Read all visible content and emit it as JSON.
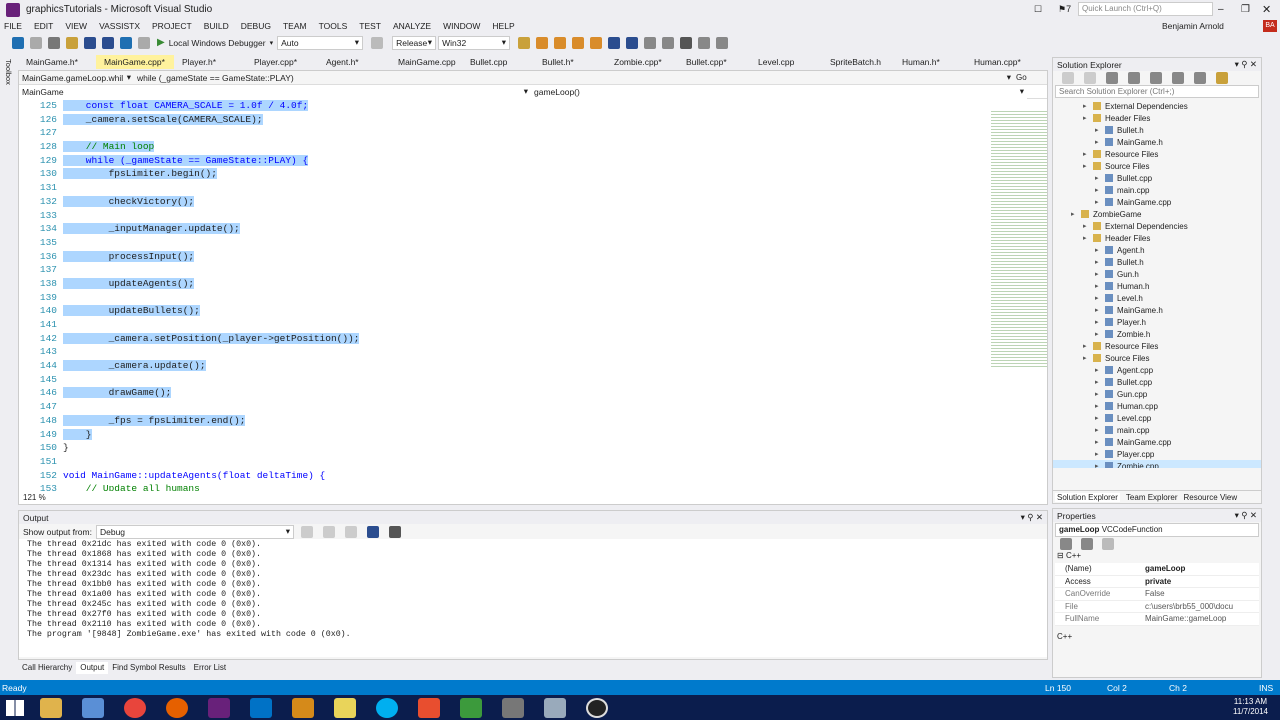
{
  "window": {
    "title": "graphicsTutorials - Microsoft Visual Studio",
    "user": "Benjamin Arnold",
    "user_initials": "BA",
    "quick_launch_placeholder": "Quick Launch (Ctrl+Q)",
    "notif_count": "7"
  },
  "menu": [
    "FILE",
    "EDIT",
    "VIEW",
    "VASSISTX",
    "PROJECT",
    "BUILD",
    "DEBUG",
    "TEAM",
    "TOOLS",
    "TEST",
    "ANALYZE",
    "WINDOW",
    "HELP"
  ],
  "toolbar": {
    "debugger": "Local Windows Debugger",
    "config1": "Auto",
    "config2": "Release",
    "platform": "Win32"
  },
  "tabs": [
    "MainGame.h*",
    "MainGame.cpp*",
    "Player.h*",
    "Player.cpp*",
    "Agent.h*",
    "MainGame.cpp",
    "Bullet.cpp",
    "Bullet.h*",
    "Zombie.cpp*",
    "Bullet.cpp*",
    "Level.cpp",
    "SpriteBatch.h",
    "Human.h*",
    "Human.cpp*"
  ],
  "nav": {
    "file": "MainGame.gameLoop.whil",
    "scope": "while (_gameState == GameState::PLAY)",
    "class": "MainGame",
    "member": "gameLoop()",
    "go": "Go"
  },
  "code": [
    {
      "n": "125",
      "t": "    const float CAMERA_SCALE = 1.0f / 4.0f;",
      "sel": true
    },
    {
      "n": "126",
      "t": "    _camera.setScale(CAMERA_SCALE);",
      "sel": true
    },
    {
      "n": "127",
      "t": "",
      "sel": true
    },
    {
      "n": "128",
      "t": "    // Main loop",
      "sel": true
    },
    {
      "n": "129",
      "t": "    while (_gameState == GameState::PLAY) {",
      "sel": true
    },
    {
      "n": "130",
      "t": "        fpsLimiter.begin();",
      "sel": true
    },
    {
      "n": "131",
      "t": "",
      "sel": true
    },
    {
      "n": "132",
      "t": "        checkVictory();",
      "sel": true
    },
    {
      "n": "133",
      "t": "",
      "sel": true
    },
    {
      "n": "134",
      "t": "        _inputManager.update();",
      "sel": true
    },
    {
      "n": "135",
      "t": "",
      "sel": true
    },
    {
      "n": "136",
      "t": "        processInput();",
      "sel": true
    },
    {
      "n": "137",
      "t": "",
      "sel": true
    },
    {
      "n": "138",
      "t": "        updateAgents();",
      "sel": true
    },
    {
      "n": "139",
      "t": "",
      "sel": true
    },
    {
      "n": "140",
      "t": "        updateBullets();",
      "sel": true
    },
    {
      "n": "141",
      "t": "",
      "sel": true
    },
    {
      "n": "142",
      "t": "        _camera.setPosition(_player->getPosition());",
      "sel": true
    },
    {
      "n": "143",
      "t": "",
      "sel": true
    },
    {
      "n": "144",
      "t": "        _camera.update();",
      "sel": true
    },
    {
      "n": "145",
      "t": "",
      "sel": true
    },
    {
      "n": "146",
      "t": "        drawGame();",
      "sel": true
    },
    {
      "n": "147",
      "t": "",
      "sel": true
    },
    {
      "n": "148",
      "t": "        _fps = fpsLimiter.end();",
      "sel": true
    },
    {
      "n": "149",
      "t": "    }",
      "sel": true
    },
    {
      "n": "150",
      "t": "}",
      "sel": false
    },
    {
      "n": "151",
      "t": "",
      "sel": false
    },
    {
      "n": "152",
      "t": "void MainGame::updateAgents(float deltaTime) {",
      "sel": false
    },
    {
      "n": "153",
      "t": "    // Update all humans",
      "sel": false
    }
  ],
  "zoom": "121 %",
  "solution_explorer": {
    "title": "Solution Explorer",
    "search_placeholder": "Search Solution Explorer (Ctrl+;)",
    "items": [
      {
        "label": "External Dependencies",
        "indent": 2
      },
      {
        "label": "Header Files",
        "indent": 2
      },
      {
        "label": "Bullet.h",
        "indent": 3
      },
      {
        "label": "MainGame.h",
        "indent": 3
      },
      {
        "label": "Resource Files",
        "indent": 2
      },
      {
        "label": "Source Files",
        "indent": 2
      },
      {
        "label": "Bullet.cpp",
        "indent": 3
      },
      {
        "label": "main.cpp",
        "indent": 3
      },
      {
        "label": "MainGame.cpp",
        "indent": 3
      },
      {
        "label": "ZombieGame",
        "indent": 1
      },
      {
        "label": "External Dependencies",
        "indent": 2
      },
      {
        "label": "Header Files",
        "indent": 2
      },
      {
        "label": "Agent.h",
        "indent": 3
      },
      {
        "label": "Bullet.h",
        "indent": 3
      },
      {
        "label": "Gun.h",
        "indent": 3
      },
      {
        "label": "Human.h",
        "indent": 3
      },
      {
        "label": "Level.h",
        "indent": 3
      },
      {
        "label": "MainGame.h",
        "indent": 3
      },
      {
        "label": "Player.h",
        "indent": 3
      },
      {
        "label": "Zombie.h",
        "indent": 3
      },
      {
        "label": "Resource Files",
        "indent": 2
      },
      {
        "label": "Source Files",
        "indent": 2
      },
      {
        "label": "Agent.cpp",
        "indent": 3
      },
      {
        "label": "Bullet.cpp",
        "indent": 3
      },
      {
        "label": "Gun.cpp",
        "indent": 3
      },
      {
        "label": "Human.cpp",
        "indent": 3
      },
      {
        "label": "Level.cpp",
        "indent": 3
      },
      {
        "label": "main.cpp",
        "indent": 3
      },
      {
        "label": "MainGame.cpp",
        "indent": 3
      },
      {
        "label": "Player.cpp",
        "indent": 3
      },
      {
        "label": "Zombie.cpp",
        "indent": 3,
        "selected": true
      }
    ],
    "tabs": [
      "Solution Explorer",
      "Team Explorer",
      "Resource View"
    ]
  },
  "output": {
    "title": "Output",
    "show_label": "Show output from:",
    "source": "Debug",
    "lines": [
      "The thread 0x21dc has exited with code 0 (0x0).",
      "The thread 0x1868 has exited with code 0 (0x0).",
      "The thread 0x1314 has exited with code 0 (0x0).",
      "The thread 0x23dc has exited with code 0 (0x0).",
      "The thread 0x1bb0 has exited with code 0 (0x0).",
      "The thread 0x1a00 has exited with code 0 (0x0).",
      "The thread 0x245c has exited with code 0 (0x0).",
      "The thread 0x27f0 has exited with code 0 (0x0).",
      "The thread 0x2110 has exited with code 0 (0x0).",
      "The program '[9848] ZombieGame.exe' has exited with code 0 (0x0)."
    ]
  },
  "bottom_tabs": [
    "Call Hierarchy",
    "Output",
    "Find Symbol Results",
    "Error List"
  ],
  "properties": {
    "title": "Properties",
    "object": "gameLoop",
    "object_type": "VCCodeFunction",
    "category": "C++",
    "rows": [
      {
        "k": "(Name)",
        "v": "gameLoop"
      },
      {
        "k": "Access",
        "v": "private"
      },
      {
        "k": "CanOverride",
        "v": "False"
      },
      {
        "k": "File",
        "v": "c:\\users\\brb55_000\\docu"
      },
      {
        "k": "FullName",
        "v": "MainGame::gameLoop"
      }
    ],
    "footer": "C++"
  },
  "status": {
    "left": "Ready",
    "ln": "Ln 150",
    "col": "Col 2",
    "ch": "Ch 2",
    "mode": "INS"
  },
  "taskbar": {
    "time": "11:13 AM",
    "date": "11/7/2014"
  }
}
